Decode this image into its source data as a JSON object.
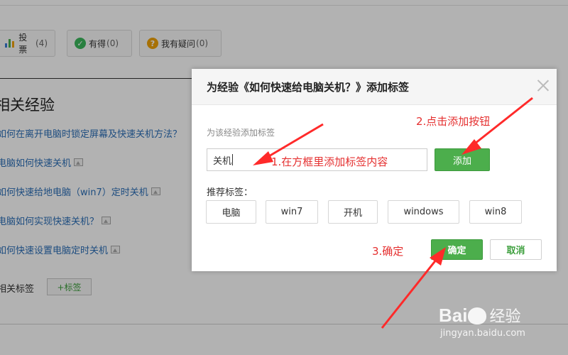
{
  "vote_bar": {
    "vote_label": "投票",
    "vote_count": "(4)",
    "got_label": "有得",
    "got_count": "(0)",
    "question_label": "我有疑问",
    "question_count": "(0)"
  },
  "related": {
    "title": "相关经验",
    "items": [
      {
        "text": "如何在离开电脑时锁定屏幕及快速关机方法？"
      },
      {
        "text": "电脑如何快速关机"
      },
      {
        "text": "如何快速给地电脑（win7）定时关机"
      },
      {
        "text": "电脑如何实现快速关机？"
      },
      {
        "text": "如何快速设置电脑定时关机"
      }
    ],
    "tags_label": "相关标签",
    "add_tag_label": "+标签"
  },
  "dialog": {
    "title": "为经验《如何快速给电脑关机？》添加标签",
    "hint": "为该经验添加标签",
    "input_value": "关机",
    "add_button": "添加",
    "recommended_label": "推荐标签：",
    "recommended_tags": [
      "电脑",
      "win7",
      "开机",
      "windows",
      "win8"
    ],
    "confirm_button": "确定",
    "cancel_button": "取消"
  },
  "annotations": {
    "step1": "1.在方框里添加标签内容",
    "step2": "2.点击添加按钮",
    "step3": "3.确定",
    "color": "#e53030"
  },
  "watermark": {
    "logo_a": "Bai",
    "logo_b": "经验",
    "url": "jingyan.baidu.com"
  },
  "colors": {
    "accent_green": "#4cae4c",
    "link_blue": "#2c6fb8",
    "overlay": "rgba(0,0,0,0.30)"
  }
}
